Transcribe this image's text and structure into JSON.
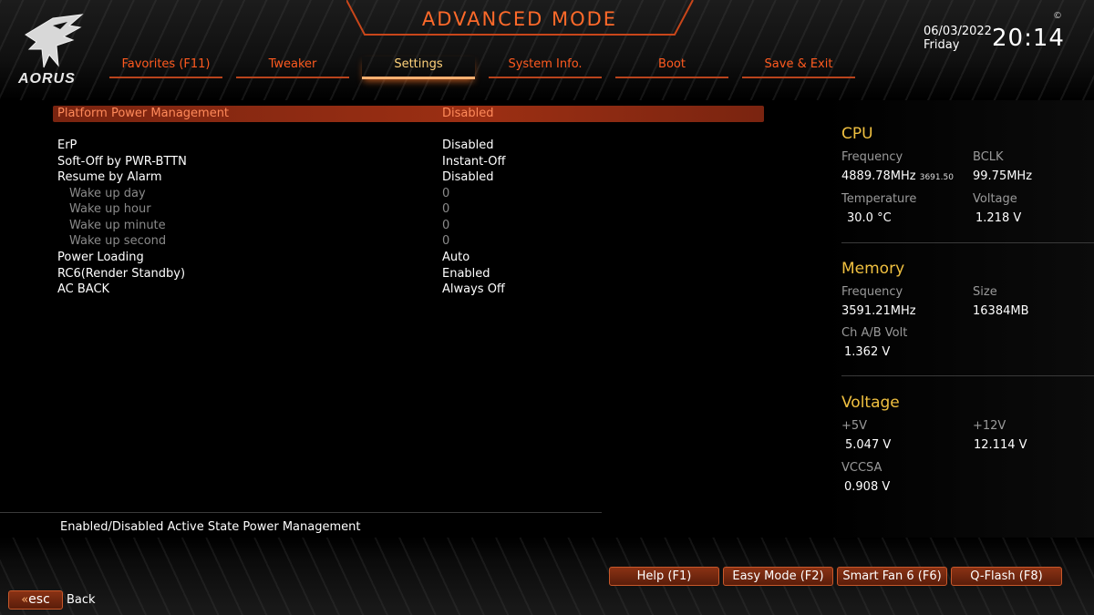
{
  "header": {
    "title": "ADVANCED MODE",
    "date": "06/03/2022",
    "day": "Friday",
    "time": "20:14",
    "logo_text": "AORUS",
    "copyright_symbol": "©"
  },
  "tabs": [
    {
      "label": "Favorites (F11)",
      "active": false
    },
    {
      "label": "Tweaker",
      "active": false
    },
    {
      "label": "Settings",
      "active": true
    },
    {
      "label": "System Info.",
      "active": false
    },
    {
      "label": "Boot",
      "active": false
    },
    {
      "label": "Save & Exit",
      "active": false
    }
  ],
  "settings": {
    "header": {
      "label": "Platform Power Management",
      "value": "Disabled"
    },
    "rows": [
      {
        "label": "ErP",
        "value": "Disabled"
      },
      {
        "label": "Soft-Off by PWR-BTTN",
        "value": "Instant-Off"
      },
      {
        "label": "Resume by Alarm",
        "value": "Disabled"
      },
      {
        "label": "Wake up day",
        "value": "0"
      },
      {
        "label": "Wake up hour",
        "value": "0"
      },
      {
        "label": "Wake up minute",
        "value": "0"
      },
      {
        "label": "Wake up second",
        "value": "0"
      },
      {
        "label": "Power Loading",
        "value": "Auto"
      },
      {
        "label": "RC6(Render Standby)",
        "value": "Enabled"
      },
      {
        "label": "AC BACK",
        "value": "Always Off"
      }
    ]
  },
  "help_text": "Enabled/Disabled Active State Power Management",
  "cpu": {
    "title": "CPU",
    "frequency_label": "Frequency",
    "frequency_value": "4889.78MHz",
    "frequency_sub": "3691.50",
    "bclk_label": "BCLK",
    "bclk_value": "99.75MHz",
    "temperature_label": "Temperature",
    "temperature_value": "30.0 °C",
    "voltage_label": "Voltage",
    "voltage_value": "1.218 V"
  },
  "memory": {
    "title": "Memory",
    "frequency_label": "Frequency",
    "frequency_value": "3591.21MHz",
    "size_label": "Size",
    "size_value": "16384MB",
    "volt_label": "Ch A/B Volt",
    "volt_value": "1.362 V"
  },
  "voltage": {
    "title": "Voltage",
    "p5v_label": "+5V",
    "p5v_value": "5.047 V",
    "p12v_label": "+12V",
    "p12v_value": "12.114 V",
    "vccsa_label": "VCCSA",
    "vccsa_value": "0.908 V"
  },
  "footer": {
    "buttons": [
      "Help (F1)",
      "Easy Mode (F2)",
      "Smart Fan 6 (F6)",
      "Q-Flash (F8)"
    ],
    "esc_label": "esc",
    "esc_chevron": "«",
    "back_label": "Back"
  },
  "colors": {
    "accent": "#ff5a1f",
    "title": "#ff6a2a",
    "section_title": "#f0c040",
    "highlight_bar": "#9c2f13",
    "active_tab": "#ffd27a"
  }
}
